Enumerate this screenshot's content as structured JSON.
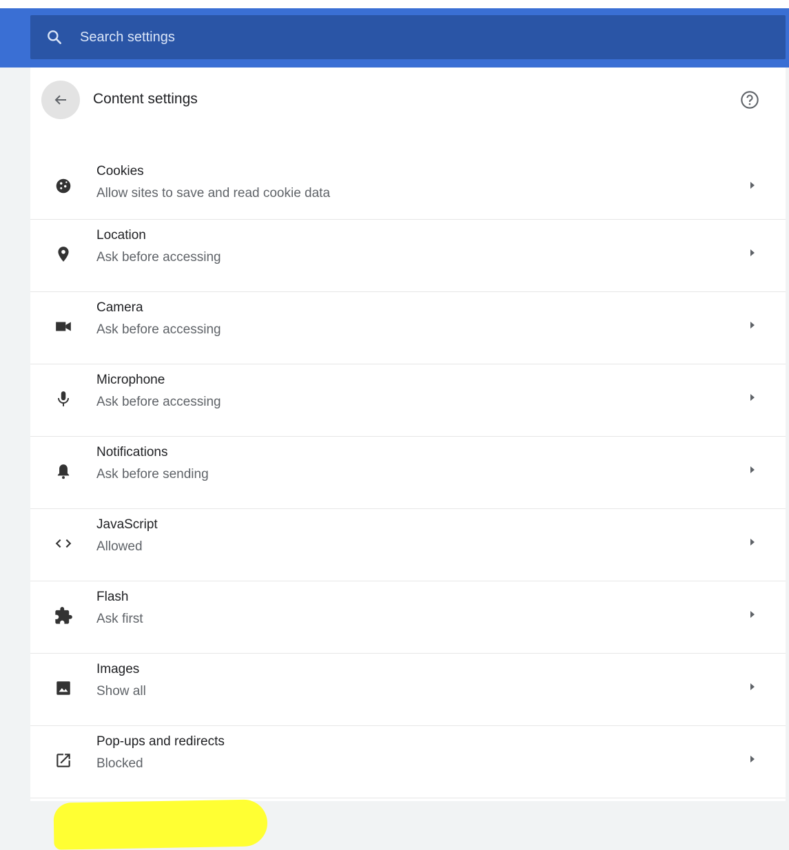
{
  "search": {
    "placeholder": "Search settings"
  },
  "header": {
    "title": "Content settings"
  },
  "items": [
    {
      "label": "Cookies",
      "sub": "Allow sites to save and read cookie data",
      "icon": "cookie-icon"
    },
    {
      "label": "Location",
      "sub": "Ask before accessing",
      "icon": "location-pin-icon"
    },
    {
      "label": "Camera",
      "sub": "Ask before accessing",
      "icon": "camera-icon"
    },
    {
      "label": "Microphone",
      "sub": "Ask before accessing",
      "icon": "microphone-icon"
    },
    {
      "label": "Notifications",
      "sub": "Ask before sending",
      "icon": "bell-icon"
    },
    {
      "label": "JavaScript",
      "sub": "Allowed",
      "icon": "code-icon"
    },
    {
      "label": "Flash",
      "sub": "Ask first",
      "icon": "puzzle-icon"
    },
    {
      "label": "Images",
      "sub": "Show all",
      "icon": "image-icon"
    },
    {
      "label": "Pop-ups and redirects",
      "sub": "Blocked",
      "icon": "open-in-new-icon",
      "highlighted": true
    }
  ],
  "colors": {
    "header_bg": "#3a6fd4",
    "search_bg": "#2a55a6",
    "highlight": "#ffff33"
  }
}
